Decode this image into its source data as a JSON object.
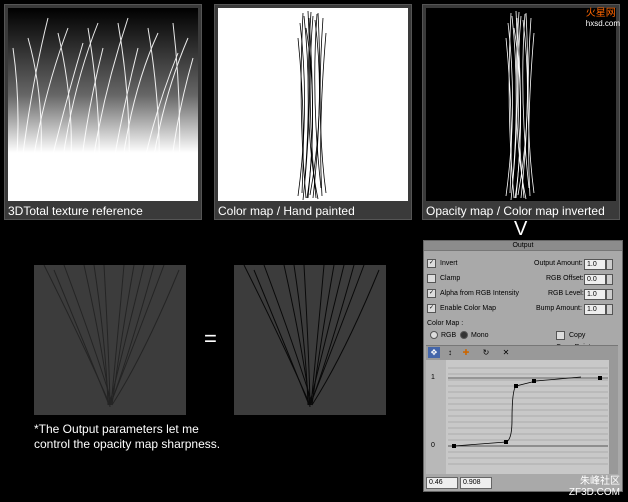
{
  "panels": [
    {
      "caption": "3DTotal texture reference"
    },
    {
      "caption": "Color map / Hand painted"
    },
    {
      "caption": "Opacity map / Color map inverted"
    }
  ],
  "logo": {
    "brand": "火星网",
    "url": "hxsd.com"
  },
  "arrow": "V",
  "equals": "=",
  "note": {
    "line1": "*The Output parameters let me",
    "line2": "control the opacity map sharpness."
  },
  "output_panel": {
    "title": "Output",
    "invert_label": "Invert",
    "clamp_label": "Clamp",
    "alpha_label": "Alpha from RGB Intensity",
    "enable_label": "Enable Color Map",
    "output_amount_label": "Output Amount:",
    "output_amount": "1.0",
    "rgb_offset_label": "RGB Offset:",
    "rgb_offset": "0.0",
    "rgb_level_label": "RGB Level:",
    "rgb_level": "1.0",
    "bump_amount_label": "Bump Amount:",
    "bump_amount": "1.0",
    "color_map_label": "Color Map :",
    "rgb_label": "RGB",
    "mono_label": "Mono",
    "copy_curve_label": "Copy CurvePoints",
    "graph_top": "1",
    "graph_bottom": "0",
    "status_x": "0.46",
    "status_y": "0.908"
  },
  "watermark": {
    "brand": "朱峰社区",
    "url": "ZF3D.COM"
  }
}
